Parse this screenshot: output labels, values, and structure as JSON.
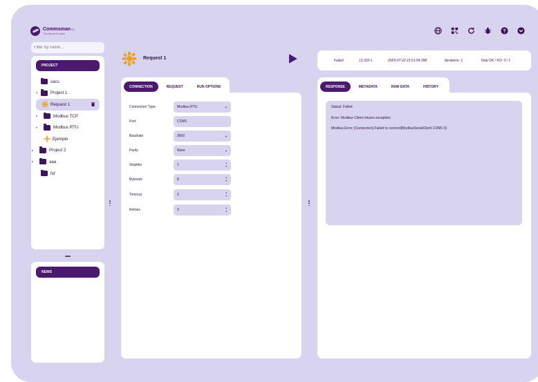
{
  "brand": {
    "name": "Commsman",
    "suffix": "v1",
    "tagline": "The future is open"
  },
  "top_icons": [
    "globe-icon",
    "qr-icon",
    "refresh-icon",
    "bug-icon",
    "help-icon",
    "chevron-down-circle-icon"
  ],
  "sidebar": {
    "filter_placeholder": "Filter by name...",
    "project_header": "PROJECT",
    "news_header": "NEWS",
    "tree": [
      {
        "label": "sacs",
        "type": "folder",
        "expandable": false
      },
      {
        "label": "Project 1",
        "type": "folder",
        "expandable": true,
        "expanded": true
      },
      {
        "label": "Request 1",
        "type": "request",
        "selected": true
      },
      {
        "label": "Modbus TCP",
        "type": "folder",
        "expandable": true
      },
      {
        "label": "Modbus RTU",
        "type": "folder",
        "expandable": true
      },
      {
        "label": "Ejemplo",
        "type": "request"
      },
      {
        "label": "Project 2",
        "type": "folder",
        "expandable": true
      },
      {
        "label": "aaa",
        "type": "folder",
        "expandable": true
      },
      {
        "label": "fsf",
        "type": "folder",
        "expandable": false
      }
    ]
  },
  "request": {
    "title": "Request 1",
    "tabs": [
      "CONNECTION",
      "REQUEST",
      "RUN OPTIONS"
    ],
    "active_tab": "CONNECTION",
    "fields": [
      {
        "label": "Connection Type:",
        "value": "Modbus RTU",
        "control": "select"
      },
      {
        "label": "Port:",
        "value": "COM1",
        "control": "text"
      },
      {
        "label": "Baudrate",
        "value": "9600",
        "control": "select"
      },
      {
        "label": "Parity",
        "value": "None",
        "control": "select"
      },
      {
        "label": "Stopbits",
        "value": "1",
        "control": "stepper"
      },
      {
        "label": "Bytesize",
        "value": "8",
        "control": "stepper"
      },
      {
        "label": "Timeout",
        "value": "3",
        "control": "stepper"
      },
      {
        "label": "Retries",
        "value": "3",
        "control": "stepper"
      }
    ]
  },
  "status": {
    "result": "Failed",
    "duration": "13.322 s",
    "timestamp": "2025-07-22 21:51:54.398",
    "iterations": "Iterations: 1",
    "total": "Total OK / KO: 0 / 1"
  },
  "response": {
    "tabs": [
      "RESPONSE",
      "METADATA",
      "RAW DATA",
      "HISTORY"
    ],
    "active_tab": "RESPONSE",
    "lines": [
      "Status: Failed",
      "Error: Modbus Client returns exception",
      "Modbus Error: [Connection] Failed to connect[ModbusSerialClient COM1:0]"
    ]
  },
  "colors": {
    "accent": "#4b1a6e",
    "background": "#d8d3ee",
    "panel": "#ffffff",
    "request_icon": "#f0a020"
  }
}
